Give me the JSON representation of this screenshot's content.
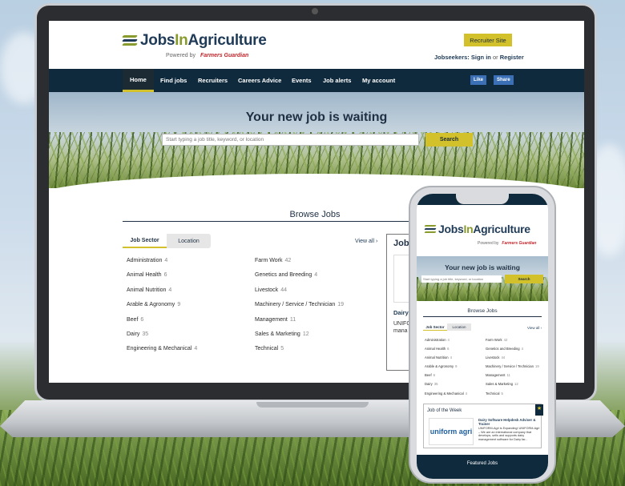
{
  "site": {
    "logo_pre": "Jobs",
    "logo_mid": "In",
    "logo_post": "Agriculture",
    "powered_by": "Powered by",
    "partner": "Farmers Guardian"
  },
  "header": {
    "recruiter_site": "Recruiter Site",
    "jobseekers": "Jobseekers:",
    "sign_in": "Sign in",
    "or": "or",
    "register": "Register"
  },
  "nav": {
    "items": [
      "Home",
      "Find jobs",
      "Recruiters",
      "Careers Advice",
      "Events",
      "Job alerts",
      "My account"
    ],
    "like": "Like",
    "share": "Share"
  },
  "hero": {
    "title": "Your new job is waiting",
    "search_placeholder": "Start typing a job title, keyword, or location",
    "search_button": "Search"
  },
  "browse": {
    "title": "Browse Jobs",
    "tabs": [
      "Job Sector",
      "Location"
    ],
    "view_all": "View all",
    "left": [
      {
        "label": "Administration",
        "count": "4"
      },
      {
        "label": "Animal Health",
        "count": "6"
      },
      {
        "label": "Animal Nutrition",
        "count": "4"
      },
      {
        "label": "Arable & Agronomy",
        "count": "9"
      },
      {
        "label": "Beef",
        "count": "6"
      },
      {
        "label": "Dairy",
        "count": "35"
      },
      {
        "label": "Engineering & Mechanical",
        "count": "4"
      }
    ],
    "right": [
      {
        "label": "Farm Work",
        "count": "42"
      },
      {
        "label": "Genetics and Breeding",
        "count": "4"
      },
      {
        "label": "Livestock",
        "count": "44"
      },
      {
        "label": "Machinery / Service / Technician",
        "count": "19"
      },
      {
        "label": "Management",
        "count": "11"
      },
      {
        "label": "Sales & Marketing",
        "count": "12"
      },
      {
        "label": "Technical",
        "count": "5"
      }
    ]
  },
  "job_of_week": {
    "title": "Job of the Week",
    "title_cut": "Job",
    "job_title_cut": "Dairy Traine",
    "desc_cut": "UNIFO We ar develo mana",
    "job_title": "Dairy Software Helpdesk Adviser & Trainer",
    "desc": "UNIFORM-Agri is Expanding! UNIFORM-Agri – We are an international company that develops, sells and supports dairy management software for Dairy far...",
    "logo_text": "uniform agri"
  },
  "featured": "Featured Jobs",
  "colors": {
    "navy": "#0f2a3d",
    "accent": "#d2c12a",
    "brand_green": "#8a9b2e"
  }
}
